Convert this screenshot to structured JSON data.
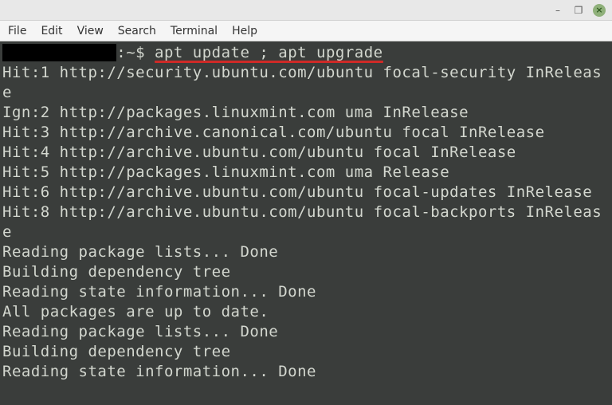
{
  "titlebar": {
    "minimize": "–",
    "maximize": "❐",
    "close": "×"
  },
  "menubar": {
    "items": [
      "File",
      "Edit",
      "View",
      "Search",
      "Terminal",
      "Help"
    ]
  },
  "prompt": {
    "redacted": "            ",
    "delim": ":~$ ",
    "command": "apt update ; apt upgrade"
  },
  "output_lines": [
    "Hit:1 http://security.ubuntu.com/ubuntu focal-security InRelease",
    "Ign:2 http://packages.linuxmint.com uma InRelease",
    "Hit:3 http://archive.canonical.com/ubuntu focal InRelease",
    "Hit:4 http://archive.ubuntu.com/ubuntu focal InRelease",
    "Hit:5 http://packages.linuxmint.com uma Release",
    "Hit:6 http://archive.ubuntu.com/ubuntu focal-updates InRelease",
    "Hit:8 http://archive.ubuntu.com/ubuntu focal-backports InRelease",
    "Reading package lists... Done",
    "Building dependency tree",
    "Reading state information... Done",
    "All packages are up to date.",
    "Reading package lists... Done",
    "Building dependency tree",
    "Reading state information... Done"
  ]
}
